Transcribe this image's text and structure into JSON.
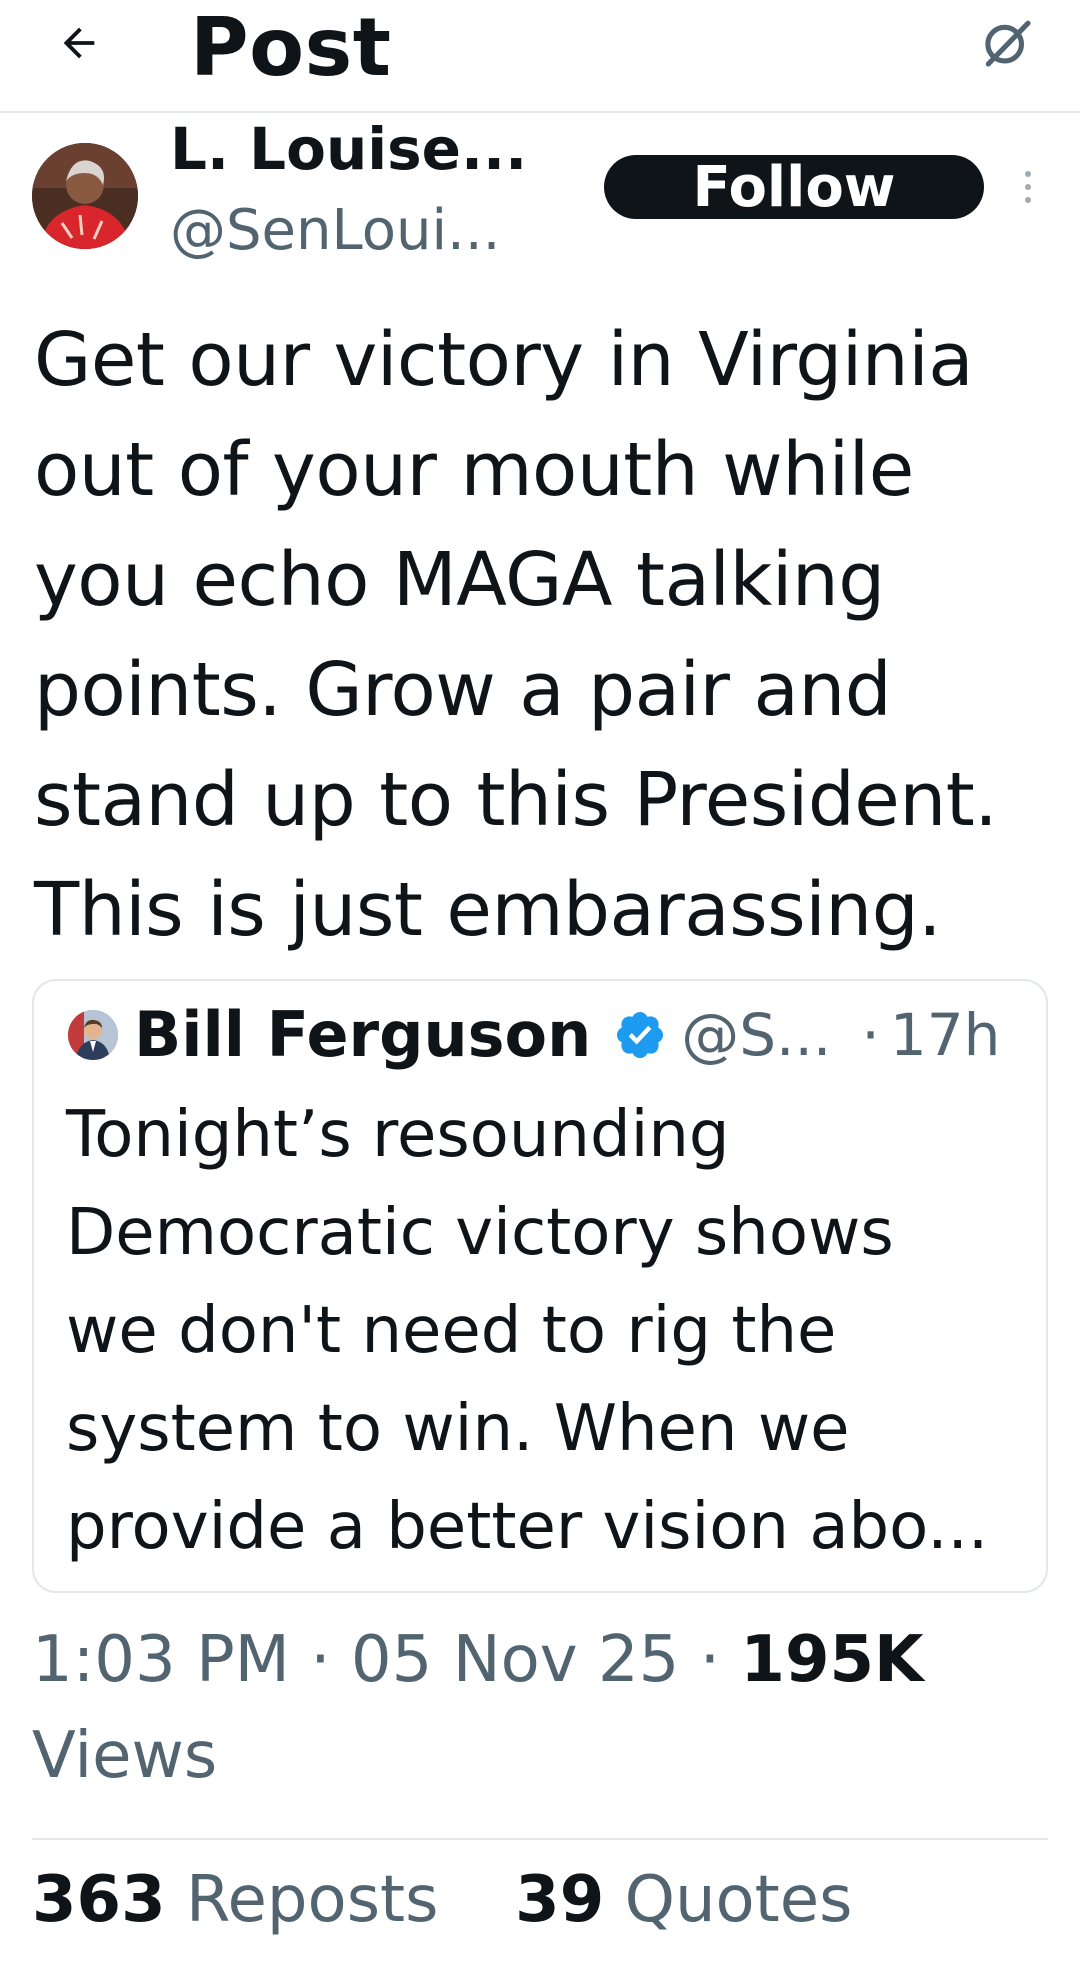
{
  "header": {
    "back_icon": "arrow-left-icon",
    "title": "Post",
    "grok_icon": "grok-icon"
  },
  "author": {
    "name": "L. Louise...",
    "handle": "@SenLoui...",
    "avatar_icon": "user-avatar",
    "follow_label": "Follow",
    "more_icon": "more-vertical-icon"
  },
  "post": {
    "text": "Get our victory in Virginia\nout of your mouth while\nyou echo MAGA talking\npoints.  Grow a pair and\nstand up to this President.\nThis is just embarassing."
  },
  "quote": {
    "name": "Bill Ferguson",
    "verified": true,
    "verified_color": "#1d9bf0",
    "handle": "@S...",
    "separator": "·",
    "time": "17h",
    "text": "Tonight’s resounding\nDemocratic victory shows\nwe don't need to rig the\nsystem to win. When we\nprovide a better vision abo..."
  },
  "meta": {
    "time": "1:03 PM",
    "date": "05 Nov 25",
    "separator": "·",
    "views_count": "195K",
    "views_label": "Views"
  },
  "stats": {
    "reposts_count": "363",
    "reposts_label": "Reposts",
    "quotes_count": "39",
    "quotes_label": "Quotes"
  },
  "colors": {
    "text": "#0f1419",
    "secondary": "#536471",
    "border": "#e6e9eb",
    "verified": "#1d9bf0"
  }
}
